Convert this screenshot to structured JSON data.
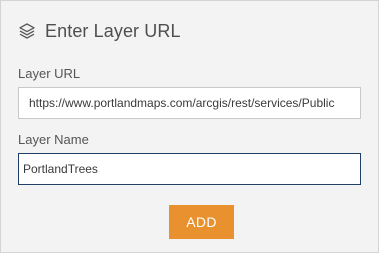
{
  "header": {
    "icon": "layers-icon",
    "title": "Enter Layer URL"
  },
  "form": {
    "url_label": "Layer URL",
    "url_value": "https://www.portlandmaps.com/arcgis/rest/services/Public",
    "name_label": "Layer Name",
    "name_value": "PortlandTrees"
  },
  "actions": {
    "add_label": "ADD"
  },
  "colors": {
    "accent": "#e8912e",
    "panel_background": "#f3f3f3",
    "focused_border": "#1f3f66"
  }
}
